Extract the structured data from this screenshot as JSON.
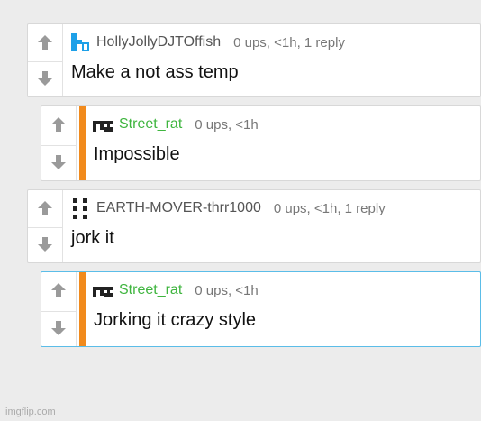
{
  "comments": [
    {
      "username": "HollyJollyDJTOffish",
      "stats": "0 ups, <1h, 1 reply",
      "text": "Make a not ass temp",
      "avatar_icon": "blue-pixel-avatar-icon",
      "username_color": "#555555"
    },
    {
      "username": "Street_rat",
      "stats": "0 ups, <1h",
      "text": "Impossible",
      "avatar_icon": "black-pixel-avatar-icon",
      "username_color": "#3fb53f"
    },
    {
      "username": "EARTH-MOVER-thrr1000",
      "stats": "0 ups, <1h, 1 reply",
      "text": "jork it",
      "avatar_icon": "dotted-avatar-icon",
      "username_color": "#555555"
    },
    {
      "username": "Street_rat",
      "stats": "0 ups, <1h",
      "text": "Jorking it crazy style",
      "avatar_icon": "black-pixel-avatar-icon",
      "username_color": "#3fb53f"
    }
  ],
  "colors": {
    "reply_bar": "#f18a1c",
    "highlight_border": "#5bbde8",
    "arrow": "#9a9a9a"
  },
  "watermark": "imgflip.com"
}
